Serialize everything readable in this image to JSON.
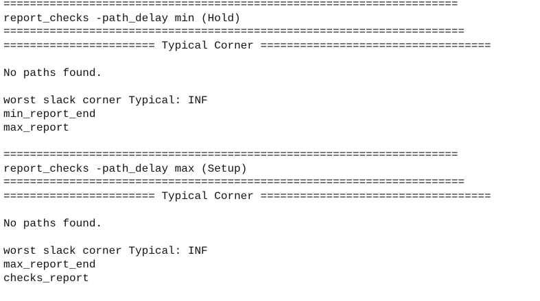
{
  "report": {
    "rule_long": "=====================================================================",
    "rule_longer": "======================================================================",
    "hold": {
      "command": "report_checks -path_delay min (Hold)",
      "corner_rule_left": "=======================",
      "corner_label": "Typical Corner",
      "corner_rule_right": "===================================",
      "no_paths": "No paths found.",
      "worst_slack": "worst slack corner Typical: INF",
      "end_marker": "min_report_end",
      "next_marker": "max_report"
    },
    "setup": {
      "command": "report_checks -path_delay max (Setup)",
      "corner_rule_left": "=======================",
      "corner_label": "Typical Corner",
      "corner_rule_right": "===================================",
      "no_paths": "No paths found.",
      "worst_slack": "worst slack corner Typical: INF",
      "end_marker": "max_report_end",
      "next_marker": "checks_report"
    }
  }
}
